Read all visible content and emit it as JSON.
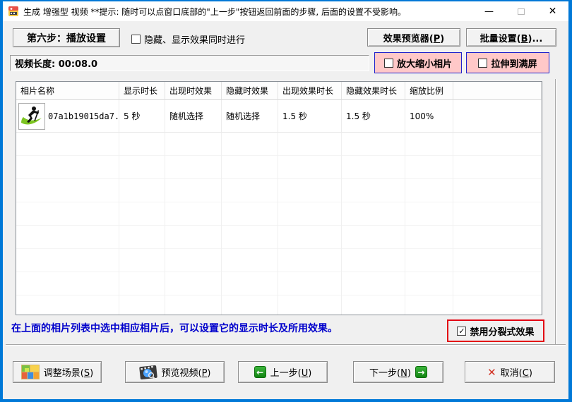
{
  "window": {
    "title": "生成 增强型 视频  **提示: 随时可以点窗口底部的\"上一步\"按钮返回前面的步骤, 后面的设置不受影响。",
    "controls": {
      "minimize_glyph": "—",
      "close_glyph": "✕"
    }
  },
  "toolbar": {
    "step_button": "第六步：播放设置",
    "sync_checkbox": {
      "label": "隐藏、显示效果同时进行",
      "glyph": "",
      "checked": false
    },
    "preview_button": {
      "pre": "效果预览器(",
      "key": "P",
      "post": ")"
    },
    "batch_button": {
      "pre": "批量设置(",
      "key": "B",
      "post": ")..."
    }
  },
  "info_row": {
    "video_length": "视频长度: 00:08.0",
    "zoom_photo": {
      "label": "放大缩小相片",
      "glyph": "",
      "checked": false
    },
    "stretch": {
      "label": "拉伸到满屏",
      "glyph": "",
      "checked": false
    }
  },
  "table": {
    "columns": [
      "相片名称",
      "显示时长",
      "出现时效果",
      "隐藏时效果",
      "出现效果时长",
      "隐藏效果时长",
      "缩放比例"
    ],
    "rows": [
      {
        "name": "07a1b19015da7...",
        "duration": "5 秒",
        "appear_effect": "随机选择",
        "hide_effect": "随机选择",
        "appear_duration": "1.5 秒",
        "hide_duration": "1.5 秒",
        "scale": "100%"
      }
    ]
  },
  "footer": {
    "hint": "在上面的相片列表中选中相应相片后，可以设置它的显示时长及所用效果。",
    "disable_split": {
      "label": "禁用分裂式效果",
      "glyph": "✓",
      "checked": true
    }
  },
  "bottom_buttons": {
    "adjust_scene": {
      "pre": "调整场景(",
      "key": "S",
      "post": ")"
    },
    "preview_video": {
      "pre": "预览视频(",
      "key": "P",
      "post": ")"
    },
    "prev_step": {
      "pre": "上一步(",
      "key": "U",
      "post": ")",
      "arrow": "←"
    },
    "next_step": {
      "pre": "下一步(",
      "key": "N",
      "post": ")",
      "arrow": "→"
    },
    "cancel": {
      "pre": "取消(",
      "key": "C",
      "post": ")",
      "x_glyph": "✕"
    }
  },
  "colors": {
    "accent_blue": "#0078d7",
    "pink_panel": "#ffc8c8",
    "pink_panel_border": "#2222cc",
    "alert_border": "#e30613",
    "hint_text": "#0000cc",
    "arrow_green": "#128412",
    "cancel_red": "#d23425"
  }
}
